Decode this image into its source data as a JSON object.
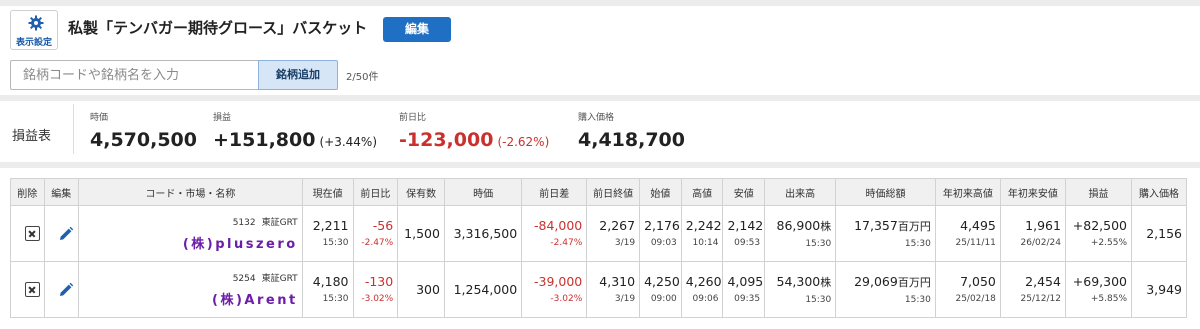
{
  "header": {
    "settings_label": "表示設定",
    "basket_title": "私製「テンバガー期待グロース」バスケット",
    "edit_label": "編集"
  },
  "search": {
    "placeholder": "銘柄コードや銘柄名を入力",
    "add_label": "銘柄追加",
    "count": "2/50件"
  },
  "pnl": {
    "label": "損益表",
    "market_value_caption": "時価",
    "market_value": "4,570,500",
    "profit_caption": "損益",
    "profit": "+151,800",
    "profit_pct": "(+3.44%)",
    "day_change_caption": "前日比",
    "day_change": "-123,000",
    "day_change_pct": "(-2.62%)",
    "cost_caption": "購入価格",
    "cost": "4,418,700"
  },
  "table": {
    "headers": [
      "削除",
      "編集",
      "コード・市場・名称",
      "現在値",
      "前日比",
      "保有数",
      "時価",
      "前日差",
      "前日終値",
      "始値",
      "高値",
      "安値",
      "出来高",
      "時価総額",
      "年初来高値",
      "年初来安値",
      "損益",
      "購入価格"
    ],
    "rows": [
      {
        "code": "5132",
        "market": "東証GRT",
        "name": "(株)pluszero",
        "price": "2,211",
        "price_time": "15:30",
        "change": "-56",
        "change_pct": "-2.47%",
        "qty": "1,500",
        "value": "3,316,500",
        "day_diff": "-84,000",
        "day_diff_pct": "-2.47%",
        "prev_close": "2,267",
        "prev_date": "3/19",
        "open": "2,176",
        "open_time": "09:03",
        "high": "2,242",
        "high_time": "10:14",
        "low": "2,142",
        "low_time": "09:53",
        "volume": "86,900",
        "volume_unit": "株",
        "volume_time": "15:30",
        "mcap": "17,357",
        "mcap_unit": "百万円",
        "mcap_time": "15:30",
        "ytd_high": "4,495",
        "ytd_high_date": "25/11/11",
        "ytd_low": "1,961",
        "ytd_low_date": "26/02/24",
        "pl": "+82,500",
        "pl_pct": "+2.55%",
        "cost": "2,156"
      },
      {
        "code": "5254",
        "market": "東証GRT",
        "name": "(株)Arent",
        "price": "4,180",
        "price_time": "15:30",
        "change": "-130",
        "change_pct": "-3.02%",
        "qty": "300",
        "value": "1,254,000",
        "day_diff": "-39,000",
        "day_diff_pct": "-3.02%",
        "prev_close": "4,310",
        "prev_date": "3/19",
        "open": "4,250",
        "open_time": "09:00",
        "high": "4,260",
        "high_time": "09:06",
        "low": "4,095",
        "low_time": "09:35",
        "volume": "54,300",
        "volume_unit": "株",
        "volume_time": "15:30",
        "mcap": "29,069",
        "mcap_unit": "百万円",
        "mcap_time": "15:30",
        "ytd_high": "7,050",
        "ytd_high_date": "25/02/18",
        "ytd_low": "2,454",
        "ytd_low_date": "25/12/12",
        "pl": "+69,300",
        "pl_pct": "+5.85%",
        "cost": "3,949"
      }
    ]
  },
  "colors": {
    "accent": "#1f70c4",
    "negative": "#c8312e",
    "stock_name": "#6b1fa8"
  },
  "icons": {
    "settings": "gear-icon",
    "delete": "delete-box-icon",
    "edit": "pencil-icon"
  }
}
